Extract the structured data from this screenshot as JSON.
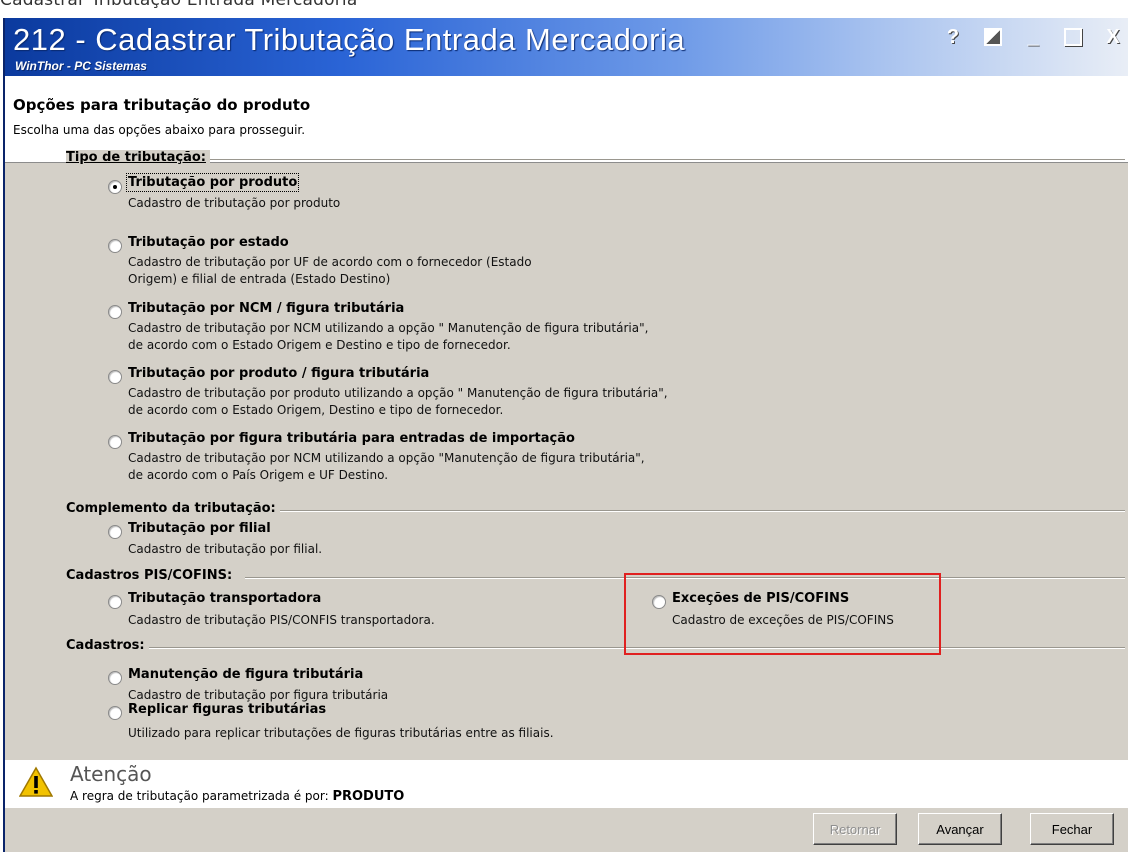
{
  "top_caption": "Cadastrar Tributação Entrada Mercadoria",
  "window": {
    "title": "212 - Cadastrar Tributação Entrada Mercadoria",
    "subtitle": "WinThor - PC Sistemas",
    "controls": [
      "?",
      "",
      "_",
      "",
      "X"
    ]
  },
  "header": {
    "title": "Opções para tributação do produto",
    "subtitle": "Escolha uma das opções abaixo para prosseguir."
  },
  "groups": {
    "tipo": "Tipo de tributação:",
    "complemento": "Complemento da tributação:",
    "pis_cofins": "Cadastros PIS/COFINS:",
    "cadastros": "Cadastros:"
  },
  "options": {
    "produto": {
      "label": "Tributação por produto",
      "desc": "Cadastro de tributação por produto",
      "checked": true
    },
    "estado": {
      "label": "Tributação por estado",
      "desc": "Cadastro de tributação por UF de acordo com o fornecedor (Estado\nOrigem) e filial de entrada (Estado Destino)"
    },
    "ncm": {
      "label": "Tributação por NCM / figura tributária",
      "desc": "Cadastro de tributação por NCM utilizando a opção \" Manutenção de figura tributária\",\nde acordo com o Estado Origem e Destino e tipo de fornecedor."
    },
    "produto_figura": {
      "label": "Tributação por produto / figura tributária",
      "desc": "Cadastro de tributação por produto utilizando a opção \" Manutenção de figura tributária\",\nde acordo com o Estado Origem, Destino e tipo de fornecedor."
    },
    "importacao": {
      "label": "Tributação por figura tributária para entradas de importação",
      "desc": "Cadastro de tributação por NCM utilizando a opção \"Manutenção de figura tributária\",\nde acordo com o País Origem e UF Destino."
    },
    "filial": {
      "label": "Tributação por filial",
      "desc": "Cadastro de tributação por filial."
    },
    "transportadora": {
      "label": "Tributação  transportadora",
      "desc": "Cadastro de tributação PIS/CONFIS transportadora."
    },
    "excecoes": {
      "label": "Exceções de PIS/COFINS",
      "desc": "Cadastro de exceções de PIS/COFINS"
    },
    "manutencao": {
      "label": "Manutenção de figura tributária",
      "desc": "Cadastro de tributação por figura tributária"
    },
    "replicar": {
      "label": "Replicar figuras tributárias",
      "desc": "Utilizado para replicar tributações de figuras tributárias entre as filiais."
    }
  },
  "attention": {
    "title": "Atenção",
    "text": "A regra de tributação parametrizada é por:",
    "value": "PRODUTO"
  },
  "buttons": {
    "retornar": "Retornar",
    "avancar": "Avançar",
    "fechar": "Fechar"
  },
  "colors": {
    "highlight": "#e02020",
    "titlebar": "#1a4cc0",
    "panel": "#d4d0c8"
  }
}
